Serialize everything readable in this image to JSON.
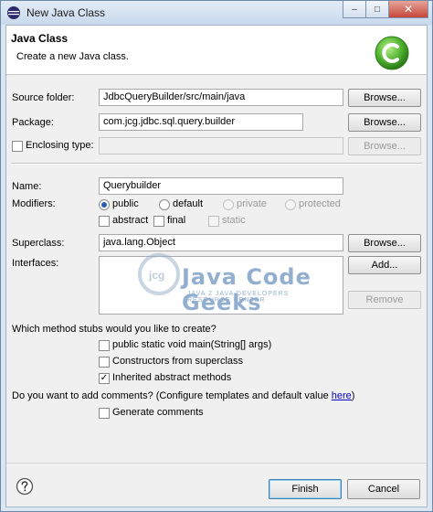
{
  "window": {
    "title": "New Java Class"
  },
  "header": {
    "title": "Java Class",
    "subtitle": "Create a new Java class."
  },
  "source_folder": {
    "label": "Source folder:",
    "value": "JdbcQueryBuilder/src/main/java",
    "button": "Browse..."
  },
  "package": {
    "label": "Package:",
    "value": "com.jcg.jdbc.sql.query.builder",
    "button": "Browse..."
  },
  "enclosing_type": {
    "label": "Enclosing type:",
    "value": "",
    "button": "Browse...",
    "checked": false
  },
  "name": {
    "label": "Name:",
    "value": "Querybuilder"
  },
  "modifiers": {
    "label": "Modifiers:",
    "access": [
      "public",
      "default",
      "private",
      "protected"
    ],
    "selected": "public",
    "abstract": "abstract",
    "final": "final",
    "static": "static"
  },
  "superclass": {
    "label": "Superclass:",
    "value": "java.lang.Object",
    "button": "Browse..."
  },
  "interfaces": {
    "label": "Interfaces:",
    "add": "Add...",
    "remove": "Remove"
  },
  "stubs": {
    "question": "Which method stubs would you like to create?",
    "main": "public static void main(String[] args)",
    "constructors": "Constructors from superclass",
    "inherited": "Inherited abstract methods"
  },
  "comments": {
    "question": "Do you want to add comments? (Configure templates and default value ",
    "link": "here",
    "suffix": ")",
    "generate": "Generate comments"
  },
  "footer": {
    "finish": "Finish",
    "cancel": "Cancel"
  },
  "watermark": {
    "title": "Java Code Geeks",
    "subtitle": "JAVA 2 JAVA DEVELOPERS RESOURCE CENTER",
    "mark": "jcg"
  },
  "window_controls": {
    "minimize": "–",
    "maximize": "□",
    "close": "✕"
  }
}
